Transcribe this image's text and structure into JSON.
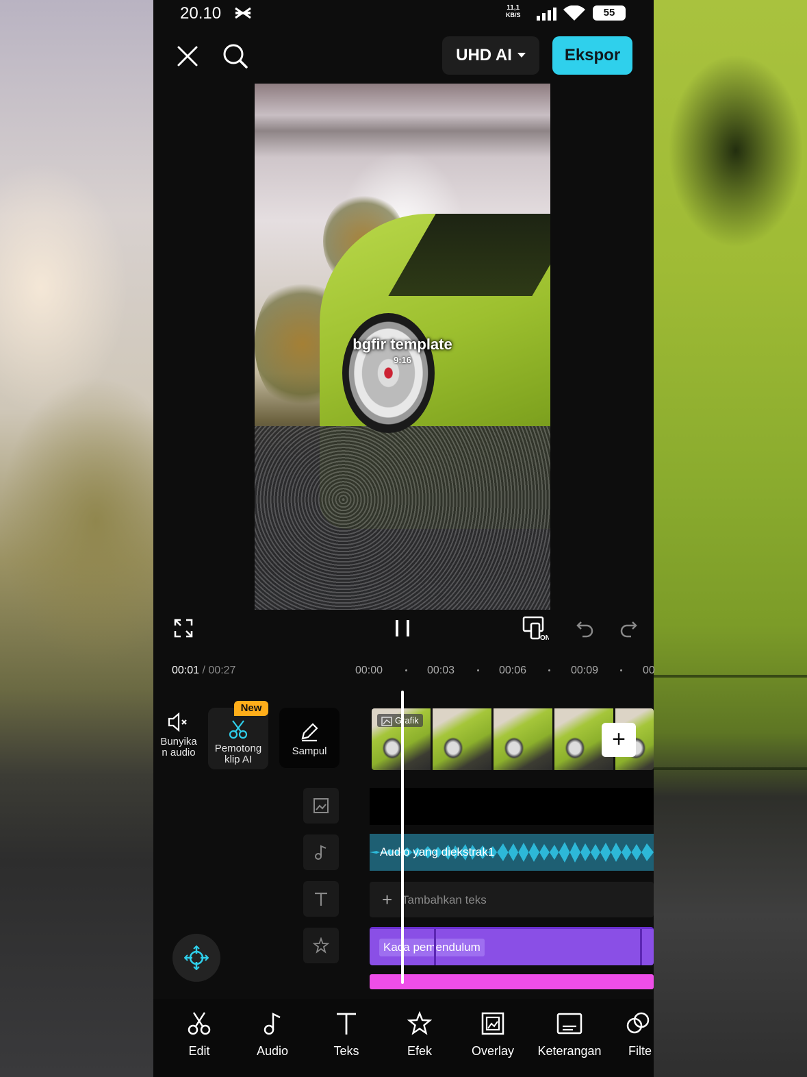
{
  "status_bar": {
    "time": "20.10",
    "net_speed_value": "11,1",
    "net_speed_unit": "KB/S",
    "battery": "55"
  },
  "top_bar": {
    "quality_label": "UHD AI",
    "export_label": "Ekspor"
  },
  "preview": {
    "title": "bgfir template",
    "aspect": "9:16"
  },
  "timeline": {
    "current_time": "00:01",
    "separator": " / ",
    "total_time": "00:27",
    "ticks": [
      "00:00",
      "00:03",
      "00:06",
      "00:09",
      "00"
    ]
  },
  "tools": {
    "mute_label": "Bunyika\nn audio",
    "cutter_label": "Pemotong\nklip AI",
    "new_badge": "New",
    "cover_label": "Sampul"
  },
  "tracks": {
    "clip_tag": "Grafik",
    "audio_label": "Audio yang diekstrak1",
    "text_placeholder": "Tambahkan teks",
    "effect_label": "Kaca pemendulum"
  },
  "bottom_nav": [
    {
      "label": "Edit",
      "icon": "scissors-icon"
    },
    {
      "label": "Audio",
      "icon": "music-note-icon"
    },
    {
      "label": "Teks",
      "icon": "text-icon"
    },
    {
      "label": "Efek",
      "icon": "star-effect-icon"
    },
    {
      "label": "Overlay",
      "icon": "overlay-icon"
    },
    {
      "label": "Keterangan",
      "icon": "captions-icon"
    },
    {
      "label": "Filte",
      "icon": "filter-icon"
    }
  ],
  "colors": {
    "accent": "#2fd0ec",
    "audio_track": "#1e5f73",
    "effect_track": "#8a4fe6",
    "pink_track": "#ee4ee8",
    "new_badge": "#ffae1a"
  }
}
